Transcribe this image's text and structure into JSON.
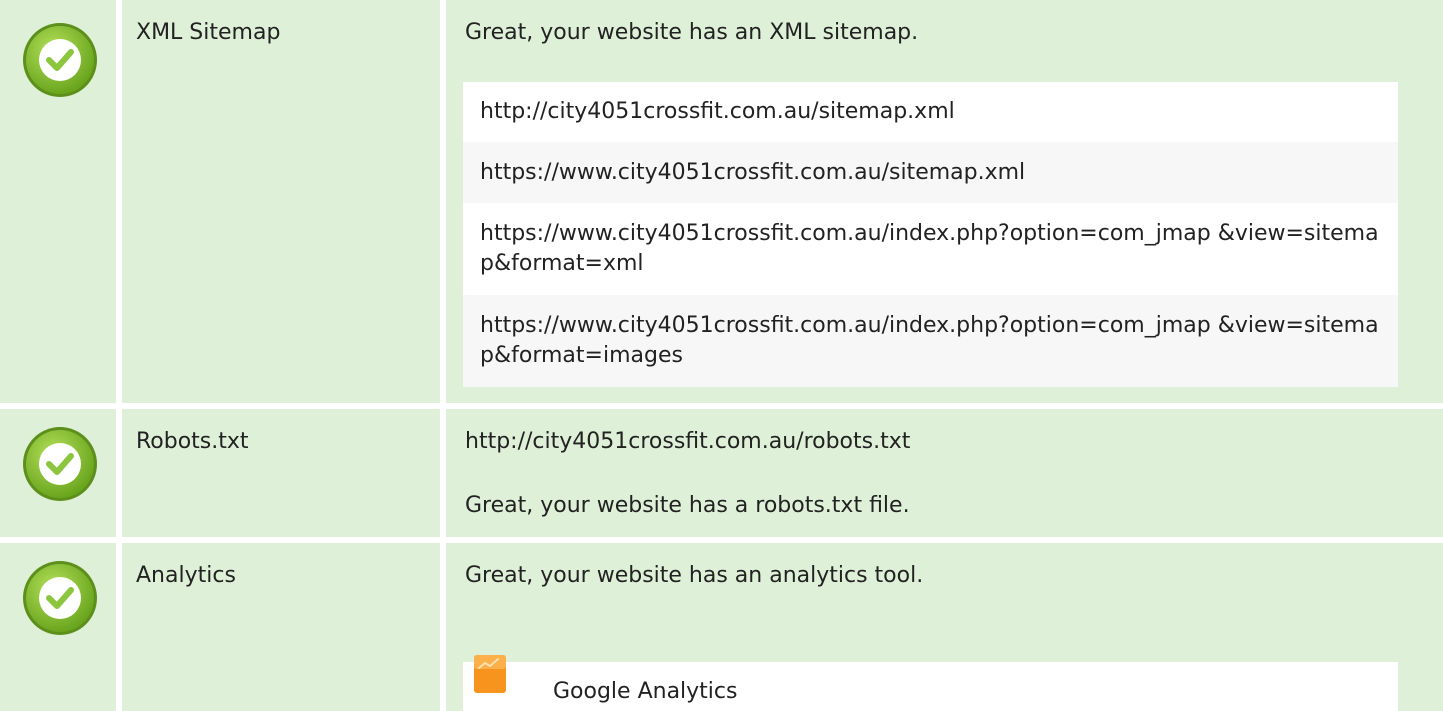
{
  "rows": [
    {
      "icon": "check-circle-icon",
      "label": "XML Sitemap",
      "message": "Great, your website has an XML sitemap.",
      "urls": [
        "http://city4051crossfit.com.au/sitemap.xml",
        "https://www.city4051crossfit.com.au/sitemap.xml",
        "https://www.city4051crossfit.com.au/index.php?option=com_jmap &view=sitemap&format=xml",
        "https://www.city4051crossfit.com.au/index.php?option=com_jmap &view=sitemap&format=images"
      ]
    },
    {
      "icon": "check-circle-icon",
      "label": "Robots.txt",
      "url": "http://city4051crossfit.com.au/robots.txt",
      "message": "Great, your website has a robots.txt file."
    },
    {
      "icon": "check-circle-icon",
      "label": "Analytics",
      "message": "Great, your website has an analytics tool.",
      "tools": [
        {
          "icon": "google-analytics-icon",
          "name": "Google Analytics"
        }
      ]
    }
  ],
  "colors": {
    "row_background": "#dff0d8",
    "check_green": "#8cc63e",
    "analytics_orange": "#f7941d"
  }
}
